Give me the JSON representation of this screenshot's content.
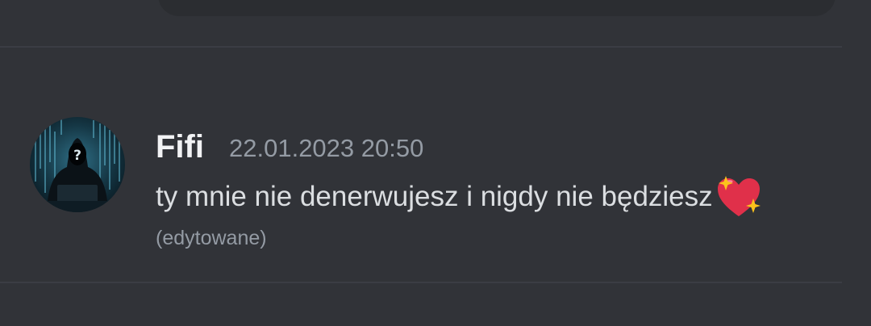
{
  "message": {
    "author": "Fifi",
    "timestamp": "22.01.2023 20:50",
    "text": "ty mnie nie denerwujesz i nigdy nie będziesz",
    "emoji": "sparkling-heart",
    "edited_label": "(edytowane)"
  },
  "avatar": {
    "glyph": "?"
  },
  "colors": {
    "background": "#313338",
    "divider": "#3b3d44",
    "username": "#f2f3f5",
    "muted": "#949ba4",
    "text": "#dbdee1",
    "heart": "#e0304a",
    "sparkle": "#fcc21b"
  }
}
